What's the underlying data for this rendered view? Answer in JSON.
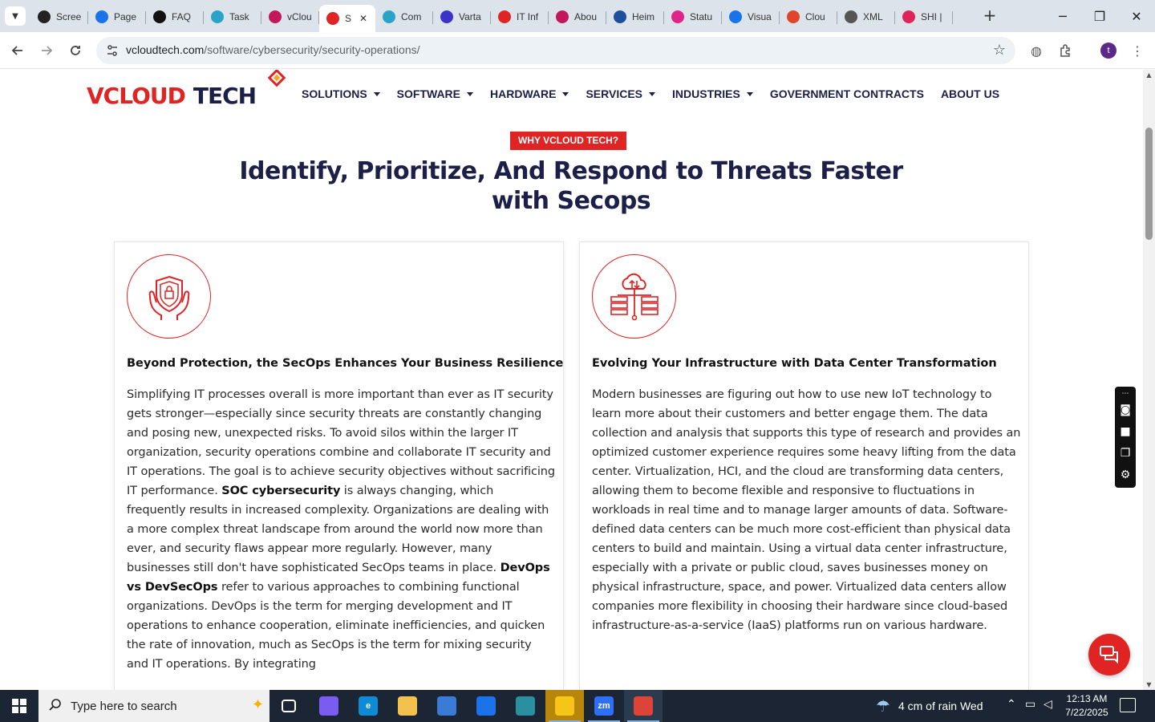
{
  "browser": {
    "tabs": [
      {
        "title": "Scree",
        "icon": "screencast-icon",
        "color": "#222222"
      },
      {
        "title": "Page",
        "icon": "speed-gauge-icon",
        "color": "#1a73e8"
      },
      {
        "title": "FAQ",
        "icon": "openai-icon",
        "color": "#111111"
      },
      {
        "title": "Task",
        "icon": "task-icon",
        "color": "#2aa3c9"
      },
      {
        "title": "vClou",
        "icon": "vcloud-icon",
        "color": "#c2185b"
      },
      {
        "title": "S",
        "icon": "vcloud-diamond-icon",
        "color": "#e02424",
        "active": true
      },
      {
        "title": "Com",
        "icon": "compass-icon",
        "color": "#2aa3c9"
      },
      {
        "title": "Varta",
        "icon": "x-cross-icon",
        "color": "#3c32c8"
      },
      {
        "title": "IT Inf",
        "icon": "vcloud-diamond-icon",
        "color": "#e02424"
      },
      {
        "title": "Abou",
        "icon": "diamond-pink-icon",
        "color": "#c2185b"
      },
      {
        "title": "Heim",
        "icon": "network-icon",
        "color": "#1f4e9c"
      },
      {
        "title": "Statu",
        "icon": "status-icon",
        "color": "#e0248a"
      },
      {
        "title": "Visua",
        "icon": "pulse-icon",
        "color": "#1a73e8"
      },
      {
        "title": "Clou",
        "icon": "cloud-swoosh-icon",
        "color": "#e0452a"
      },
      {
        "title": "XML",
        "icon": "globe-icon",
        "color": "#555555"
      },
      {
        "title": "SHI |",
        "icon": "shi-ring-icon",
        "color": "#e0245a"
      }
    ],
    "close_glyph": "✕",
    "newtab_glyph": "+",
    "url_host": "vcloudtech.com",
    "url_path": "/software/cybersecurity/security-operations/",
    "profile_initial": "t"
  },
  "site": {
    "logo": {
      "v": "V",
      "cloud": "CLOUD",
      "tech": "TECH"
    },
    "nav": [
      {
        "label": "SOLUTIONS",
        "dropdown": true
      },
      {
        "label": "SOFTWARE",
        "dropdown": true
      },
      {
        "label": "HARDWARE",
        "dropdown": true
      },
      {
        "label": "SERVICES",
        "dropdown": true
      },
      {
        "label": "INDUSTRIES",
        "dropdown": true
      },
      {
        "label": "GOVERNMENT CONTRACTS",
        "dropdown": false
      },
      {
        "label": "ABOUT US",
        "dropdown": false
      }
    ],
    "eyebrow": "WHY VCLOUD TECH?",
    "heading_line1": "Identify, Prioritize, And Respond to Threats Faster",
    "heading_line2": "with Secops",
    "cards": [
      {
        "icon": "shield-hands-icon",
        "title": "Beyond Protection, the SecOps Enhances Your Business Resilience",
        "body_parts": [
          {
            "text": "Simplifying IT processes overall is more important than ever as IT security gets stronger—especially since security threats are constantly changing and posing new, unexpected risks. To avoid silos within the larger IT organization, security operations combine and collaborate IT security and IT operations. The goal is to achieve security objectives without sacrificing IT performance. ",
            "bold": false
          },
          {
            "text": "SOC cybersecurity",
            "bold": true
          },
          {
            "text": " is always changing, which frequently results in increased complexity. Organizations are dealing with a more complex threat landscape from around the world now more than ever, and security flaws appear more regularly. However, many businesses still don't have sophisticated SecOps teams in place. ",
            "bold": false
          },
          {
            "text": "DevOps vs DevSecOps",
            "bold": true
          },
          {
            "text": " refer to various approaches to combining functional organizations. DevOps is the term for merging development and IT operations to enhance cooperation, eliminate inefficiencies, and quicken the rate of innovation, much as SecOps is the term for mixing security and IT operations. By integrating",
            "bold": false
          }
        ]
      },
      {
        "icon": "cloud-datacenter-icon",
        "title": "Evolving Your Infrastructure with Data Center Transformation",
        "body_parts": [
          {
            "text": "Modern businesses are figuring out how to use new IoT technology to learn more about their customers and better engage them. The data collection and analysis that supports this type of research and provides an optimized customer experience requires some heavy lifting from the data center. Virtualization, HCI, and the cloud are transforming data centers, allowing them to become flexible and responsive to fluctuations in workloads in real time and to manage larger amounts of data. Software-defined data centers can be much more cost-efficient than physical data centers to build and maintain. Using a virtual data center infrastructure, especially with a private or public cloud, saves businesses money on physical infrastructure, space, and power. Virtualized data centers allow companies more flexibility in choosing their hardware since cloud-based infrastructure-as-a-service (IaaS) platforms run on various hardware.",
            "bold": false
          }
        ]
      }
    ]
  },
  "colors": {
    "accent": "#e02424",
    "navy": "#1c2048",
    "taskbar": "#1b2533"
  },
  "taskbar": {
    "search_placeholder": "Type here to search",
    "weather": "4 cm of rain Wed",
    "time": "12:13 AM",
    "date": "7/22/2025",
    "apps": [
      {
        "name": "task-view",
        "label": "",
        "color": "#1b2533"
      },
      {
        "name": "copilot",
        "label": "",
        "color": "#7b5cf0"
      },
      {
        "name": "edge",
        "label": "e",
        "color": "#0f8bd6"
      },
      {
        "name": "file-explorer",
        "label": "",
        "color": "#f2c14e"
      },
      {
        "name": "store",
        "label": "",
        "color": "#3a7bd5"
      },
      {
        "name": "mail",
        "label": "",
        "color": "#1a73e8"
      },
      {
        "name": "app-diamond",
        "label": "",
        "color": "#2a8f9e"
      },
      {
        "name": "sticky-notes",
        "label": "",
        "color": "#f5c518"
      },
      {
        "name": "zoom",
        "label": "zm",
        "color": "#2d6ff7"
      },
      {
        "name": "chrome",
        "label": "",
        "color": "#db4437"
      }
    ]
  }
}
